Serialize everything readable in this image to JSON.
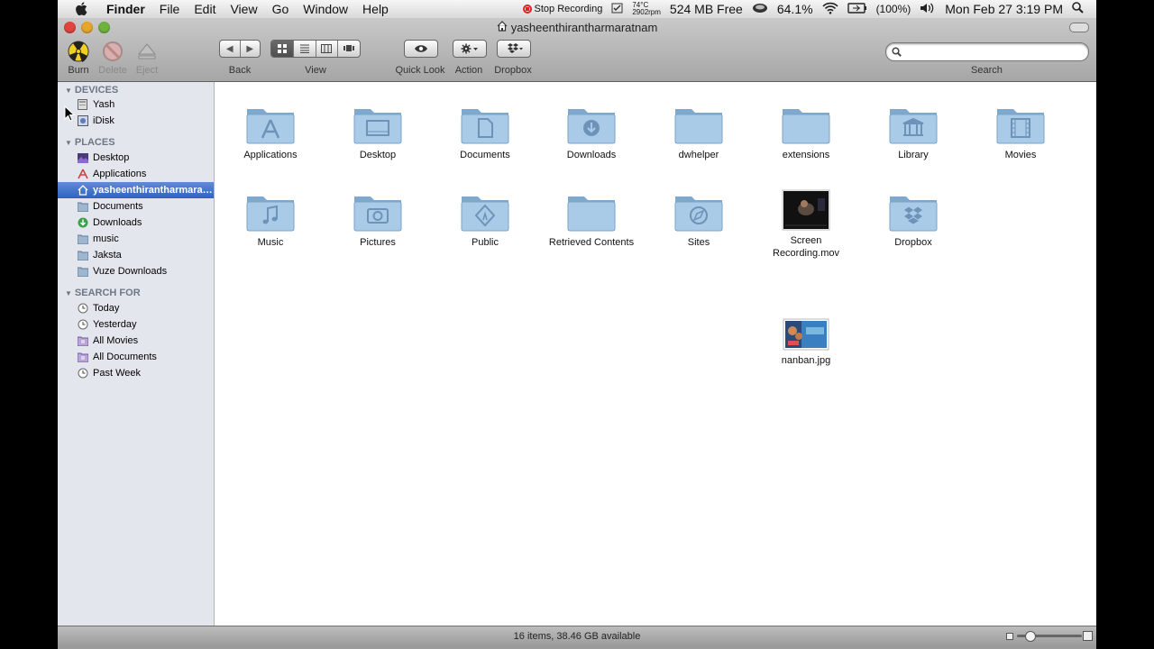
{
  "menubar": {
    "app_name": "Finder",
    "menus": [
      "File",
      "Edit",
      "View",
      "Go",
      "Window",
      "Help"
    ],
    "recording": "Stop Recording",
    "temp_line1": "74°C",
    "temp_line2": "2902rpm",
    "memory": "524 MB Free",
    "cpu": "64.1%",
    "battery": "(100%)",
    "clock": "Mon Feb 27  3:19 PM"
  },
  "window": {
    "title": "yasheenthirantharmaratnam",
    "toolbar": {
      "burn": "Burn",
      "delete": "Delete",
      "eject": "Eject",
      "back": "Back",
      "view": "View",
      "quick_look": "Quick Look",
      "action": "Action",
      "dropbox": "Dropbox",
      "search_label": "Search",
      "search_placeholder": ""
    }
  },
  "sidebar": {
    "devices_header": "DEVICES",
    "devices": [
      "Yash",
      "iDisk"
    ],
    "places_header": "PLACES",
    "places": [
      "Desktop",
      "Applications",
      "yasheenthirantharmaratnam",
      "Documents",
      "Downloads",
      "music",
      "Jaksta",
      "Vuze Downloads"
    ],
    "search_header": "SEARCH FOR",
    "searches": [
      "Today",
      "Yesterday",
      "All Movies",
      "All Documents",
      "Past Week"
    ]
  },
  "content": {
    "items": [
      "Applications",
      "Desktop",
      "Documents",
      "Downloads",
      "dwhelper",
      "extensions",
      "Library",
      "Movies",
      "Music",
      "Pictures",
      "Public",
      "Retrieved Contents",
      "Sites",
      "Screen Recording.mov",
      "Dropbox",
      "nanban.jpg"
    ]
  },
  "status": {
    "text": "16 items, 38.46 GB available",
    "icon_size_fraction": 0.2
  },
  "colors": {
    "folder": "#9fc4e4",
    "selection": "#3b6fca",
    "sidebar_bg": "#e3e7ed"
  }
}
